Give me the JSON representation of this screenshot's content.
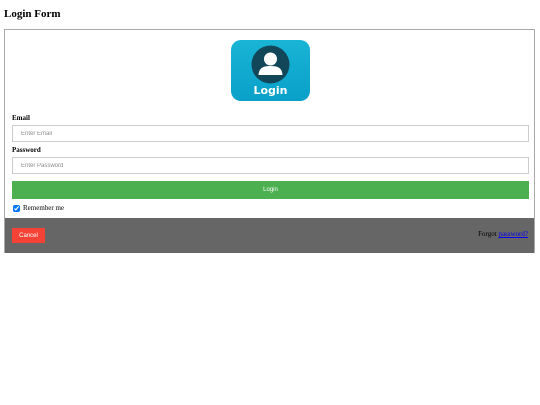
{
  "page": {
    "title": "Login Form"
  },
  "avatar": {
    "caption": "Login",
    "tile_color": "#0aa0c8",
    "icon": "user-icon"
  },
  "email": {
    "label": "Email",
    "placeholder": "Enter Email",
    "value": ""
  },
  "password": {
    "label": "Password",
    "placeholder": "Enter Password",
    "value": ""
  },
  "actions": {
    "login_label": "Login",
    "login_color": "#4caf50",
    "remember_label": "Remember me",
    "remember_checked": true,
    "cancel_label": "Cancel",
    "cancel_color": "#f44336"
  },
  "footer": {
    "forgot_prefix": "Forgot",
    "forgot_link": "password?",
    "background": "#666666"
  }
}
